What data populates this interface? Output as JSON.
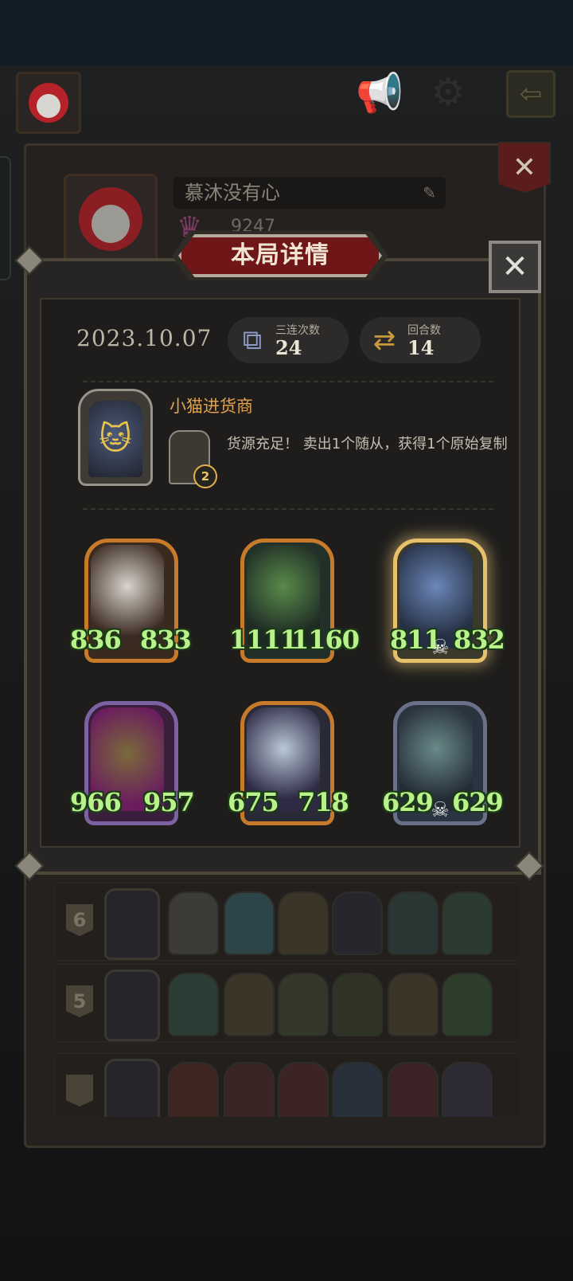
{
  "top_bar": {
    "avatar_icon": "player-avatar-icon",
    "sound_icon": "megaphone-icon",
    "settings_icon": "gear-icon",
    "exit_icon": "exit-arrow-icon"
  },
  "profile": {
    "name": "慕沐没有心",
    "score": "9247"
  },
  "modal": {
    "title": "本局详情",
    "date": "2023.10.07",
    "triples_label": "三连次数",
    "triples_value": "24",
    "rounds_label": "回合数",
    "rounds_value": "14",
    "hero": {
      "name": "小猫进货商",
      "power_cost": "2",
      "power_description": "货源充足！ 卖出1个随从，获得1个原始复制"
    },
    "minions": [
      {
        "attack": "836",
        "health": "833",
        "frame": "gold",
        "art": "bull-terrier-butcher"
      },
      {
        "attack": "1111",
        "health": "1160",
        "frame": "gold",
        "art": "toothy-goblin"
      },
      {
        "attack": "811",
        "health": "832",
        "frame": "golden-glow",
        "art": "armored-knight",
        "skull": true
      },
      {
        "attack": "966",
        "health": "957",
        "frame": "purple",
        "art": "witch-hat-elder"
      },
      {
        "attack": "675",
        "health": "718",
        "frame": "gold",
        "art": "elf-sorceress"
      },
      {
        "attack": "629",
        "health": "629",
        "frame": "steel",
        "art": "mech-knight",
        "skull": true
      }
    ]
  },
  "history": {
    "rows": [
      {
        "round": "6"
      },
      {
        "round": "5"
      },
      {
        "round": ""
      }
    ]
  },
  "colors": {
    "stat_green": "#b9f28a",
    "hero_name": "#e0a44e",
    "banner_red": "#6e1618"
  }
}
